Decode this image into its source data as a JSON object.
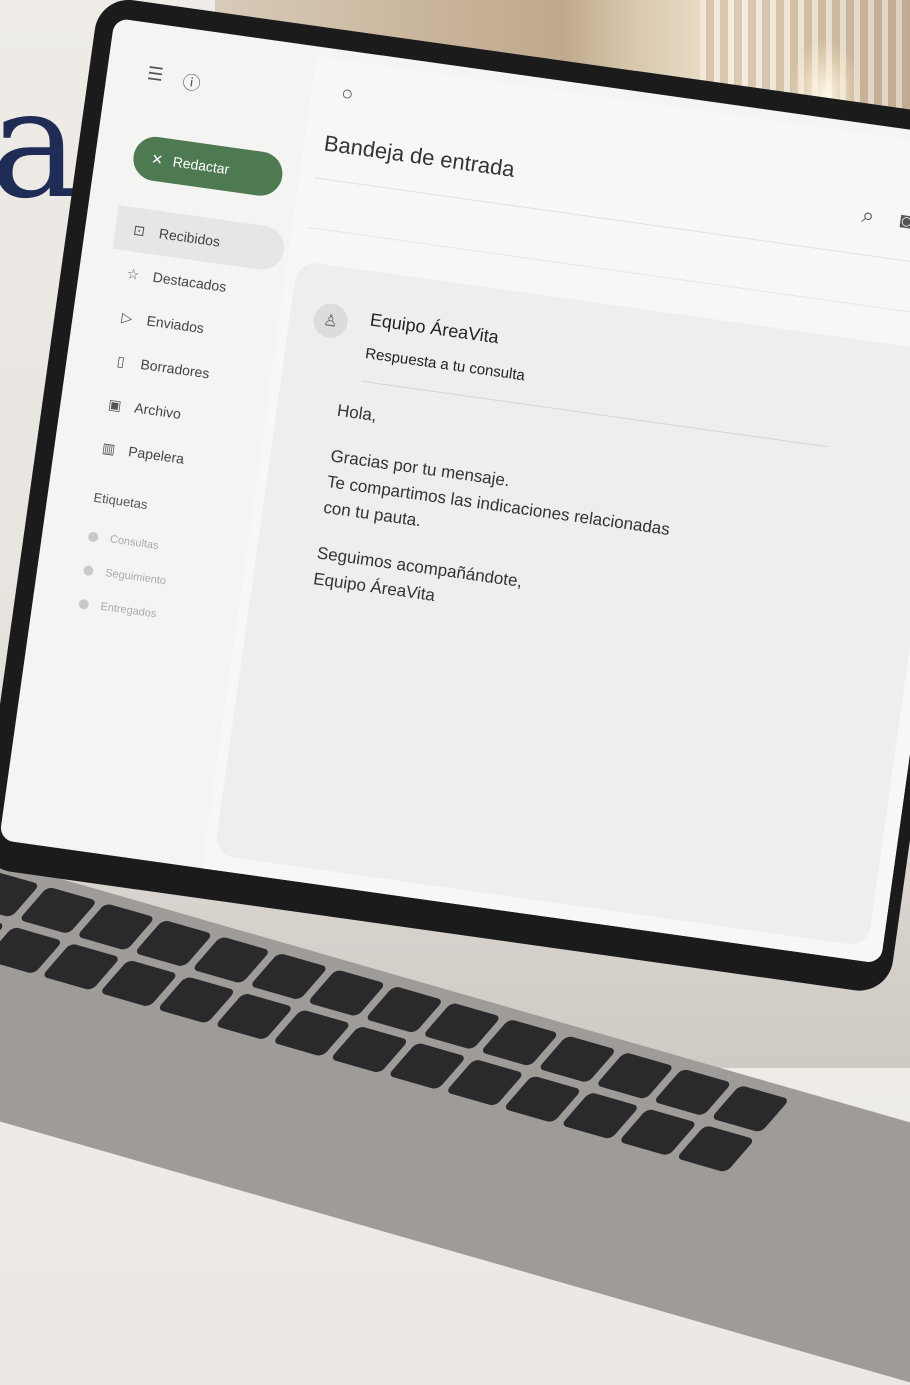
{
  "brand": {
    "letter": "a"
  },
  "app": {
    "compose_label": "Redactar",
    "nav": [
      {
        "label": "Recibidos",
        "icon": "inbox-icon",
        "active": true
      },
      {
        "label": "Destacados",
        "icon": "star-icon",
        "active": false
      },
      {
        "label": "Enviados",
        "icon": "send-icon",
        "active": false
      },
      {
        "label": "Borradores",
        "icon": "draft-icon",
        "active": false
      },
      {
        "label": "Archivo",
        "icon": "archive-icon",
        "active": false
      },
      {
        "label": "Papelera",
        "icon": "trash-icon",
        "active": false
      }
    ],
    "labels_title": "Etiquetas",
    "labels": [
      {
        "label": "Consultas"
      },
      {
        "label": "Seguimiento"
      },
      {
        "label": "Entregados"
      }
    ]
  },
  "mail": {
    "folder_title": "Bandeja de entrada",
    "message": {
      "sender": "Equipo ÁreaVita",
      "subject": "Respuesta a tu consulta",
      "greeting": "Hola,",
      "line1": "Gracias por tu mensaje.",
      "line2": "Te compartimos las indicaciones relacionadas",
      "line3": "con tu pauta.",
      "closing": "Seguimos acompañándote,",
      "signature": "Equipo ÁreaVita"
    }
  },
  "colors": {
    "compose": "#4e7a52",
    "brand_letter": "#1f2c56"
  }
}
